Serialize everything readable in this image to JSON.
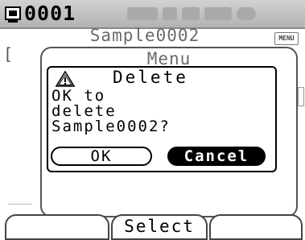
{
  "header": {
    "measurement_id": "0001",
    "id_icon": "target-id-icon",
    "status_icons": [
      "status-indicator-icon",
      "status-indicator-icon",
      "status-indicator-icon",
      "status-indicator-icon",
      "status-indicator-icon"
    ]
  },
  "background": {
    "sample_title": "Sample0002",
    "menu_badge": "MENU",
    "bracket_glyph": "["
  },
  "menu": {
    "title": "Menu"
  },
  "dialog": {
    "icon": "warning-icon",
    "title": "Delete",
    "message": "OK to\ndelete\nSample0002?",
    "ok_label": "OK",
    "cancel_label": "Cancel",
    "selected": "Cancel"
  },
  "softkeys": {
    "left": "",
    "middle": "Select",
    "right": ""
  },
  "colors": {
    "topbar": "#c4c4c4",
    "selected_button_bg": "#000000",
    "selected_button_text": "#ffffff"
  }
}
